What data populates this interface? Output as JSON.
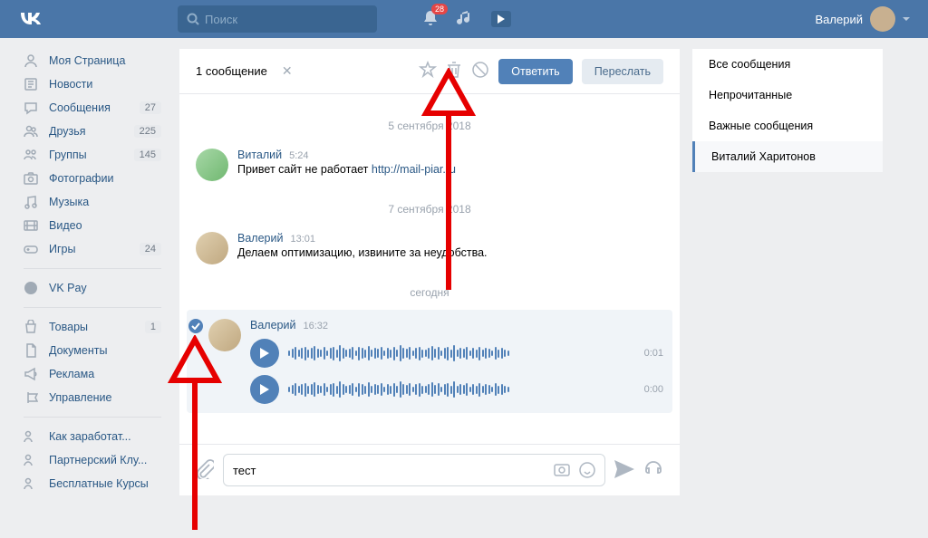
{
  "header": {
    "search_placeholder": "Поиск",
    "notif_count": "28",
    "username": "Валерий"
  },
  "sidebar": {
    "items": [
      {
        "label": "Моя Страница",
        "icon": "home",
        "count": ""
      },
      {
        "label": "Новости",
        "icon": "news",
        "count": ""
      },
      {
        "label": "Сообщения",
        "icon": "msg",
        "count": "27"
      },
      {
        "label": "Друзья",
        "icon": "friends",
        "count": "225"
      },
      {
        "label": "Группы",
        "icon": "groups",
        "count": "145"
      },
      {
        "label": "Фотографии",
        "icon": "photo",
        "count": ""
      },
      {
        "label": "Музыка",
        "icon": "music",
        "count": ""
      },
      {
        "label": "Видео",
        "icon": "video",
        "count": ""
      },
      {
        "label": "Игры",
        "icon": "games",
        "count": "24"
      }
    ],
    "pay_label": "VK Pay",
    "extra": [
      {
        "label": "Товары",
        "icon": "shop",
        "count": "1"
      },
      {
        "label": "Документы",
        "icon": "doc",
        "count": ""
      },
      {
        "label": "Реклама",
        "icon": "ad",
        "count": ""
      },
      {
        "label": "Управление",
        "icon": "mgmt",
        "count": ""
      }
    ],
    "footer": [
      {
        "label": "Как заработат...",
        "icon": "q"
      },
      {
        "label": "Партнерский Клу...",
        "icon": "q"
      },
      {
        "label": "Бесплатные Курсы",
        "icon": "q"
      }
    ]
  },
  "toolbar": {
    "selection": "1 сообщение",
    "reply": "Ответить",
    "forward": "Переслать"
  },
  "dates": {
    "d1": "5 сентября 2018",
    "d2": "7 сентября 2018",
    "d3": "сегодня"
  },
  "msgs": {
    "m1": {
      "author": "Виталий",
      "time": "5:24",
      "text": "Привет сайт не работает ",
      "link": "http://mail-piar.ru"
    },
    "m2": {
      "author": "Валерий",
      "time": "13:01",
      "text": "Делаем оптимизацию, извините за неудобства."
    },
    "m3": {
      "author": "Валерий",
      "time": "16:32"
    },
    "v1_time": "0:01",
    "v2_time": "0:00"
  },
  "input": {
    "value": "тест"
  },
  "right": {
    "all": "Все сообщения",
    "unread": "Непрочитанные",
    "important": "Важные сообщения",
    "active": "Виталий Харитонов"
  }
}
